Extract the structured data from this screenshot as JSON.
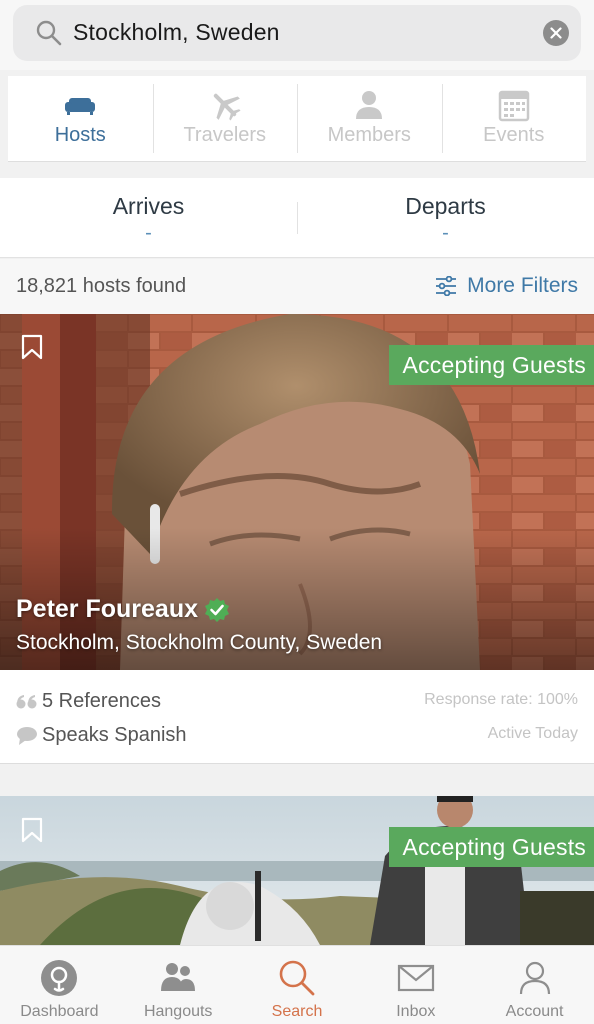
{
  "search": {
    "value": "Stockholm, Sweden"
  },
  "tabs": [
    {
      "label": "Hosts",
      "icon": "couch-icon",
      "active": true
    },
    {
      "label": "Travelers",
      "icon": "airplane-icon",
      "active": false
    },
    {
      "label": "Members",
      "icon": "person-icon",
      "active": false
    },
    {
      "label": "Events",
      "icon": "calendar-icon",
      "active": false
    }
  ],
  "dates": {
    "arrives": {
      "label": "Arrives",
      "value": "-"
    },
    "departs": {
      "label": "Departs",
      "value": "-"
    }
  },
  "results": {
    "count": "18,821 hosts found",
    "filters_label": "More Filters"
  },
  "cards": [
    {
      "badge": "Accepting Guests",
      "name": "Peter Foureaux",
      "location": "Stockholm, Stockholm County, Sweden",
      "references": "5 References",
      "languages": "Speaks Spanish",
      "response_rate": "Response rate: 100%",
      "activity": "Active Today"
    },
    {
      "badge": "Accepting Guests"
    }
  ],
  "nav": [
    {
      "label": "Dashboard",
      "icon": "dashboard-icon",
      "active": false
    },
    {
      "label": "Hangouts",
      "icon": "hangouts-icon",
      "active": false
    },
    {
      "label": "Search",
      "icon": "search-icon",
      "active": true
    },
    {
      "label": "Inbox",
      "icon": "inbox-icon",
      "active": false
    },
    {
      "label": "Account",
      "icon": "account-icon",
      "active": false
    }
  ],
  "colors": {
    "accent_blue": "#3d6f9a",
    "accepting_green": "#5aa95d",
    "search_orange": "#d4734b"
  }
}
